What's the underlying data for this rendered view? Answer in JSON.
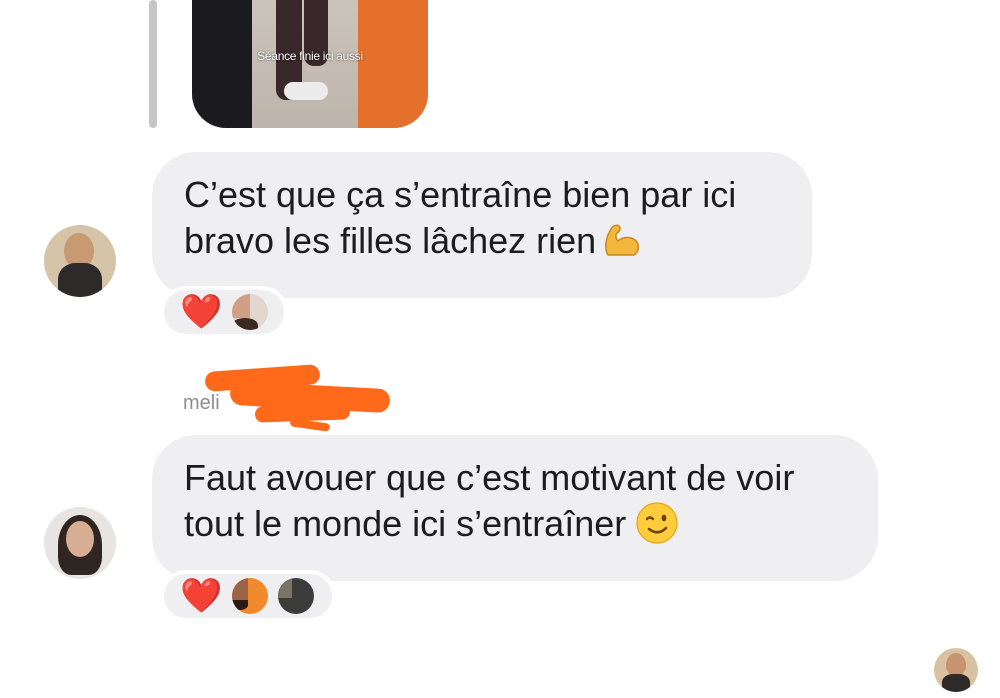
{
  "story_reply": {
    "caption": "Séance finie ici aussi"
  },
  "messages": [
    {
      "lines": [
        "C’est que ça s’entraîne bien par ici",
        "bravo les filles lâchez rien"
      ],
      "emoji": "flexed-biceps",
      "reaction": "❤️",
      "reactor_count": 1
    },
    {
      "sender": "meli",
      "lines": [
        "Faut avouer que c’est motivant de voir",
        "tout le monde ici s’entraîner"
      ],
      "emoji": "winking-face",
      "reaction": "❤️",
      "reactor_count": 2
    }
  ],
  "colors": {
    "bubble": "#efeff1",
    "heart": "#e8112d",
    "redaction": "#ff6a1a",
    "text": "#1c1c1e",
    "muted": "#8e8e93"
  }
}
